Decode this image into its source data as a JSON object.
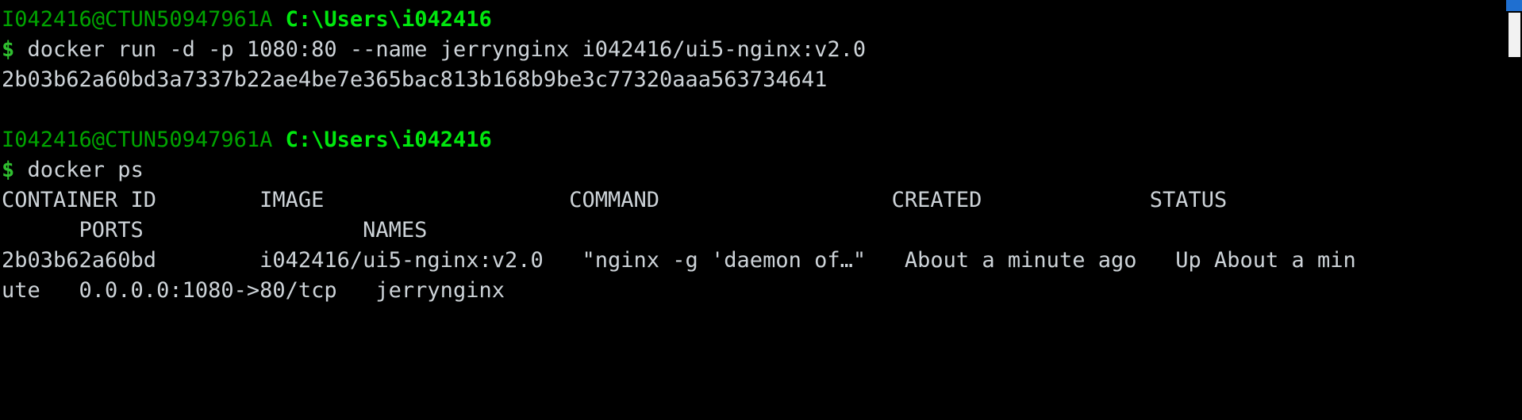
{
  "terminal": {
    "background": "#000000",
    "foreground": "#cdd3d8",
    "prompt_user_color": "#00a400",
    "prompt_path_color": "#00e80e",
    "dollar_color": "#2fbf2f",
    "scrollbar_accent_color": "#1f6fd0",
    "scrollbar_thumb_color": "#f2f2f2"
  },
  "lines": {
    "l1_user": "I042416@CTUN50947961A",
    "l1_space": " ",
    "l1_path": "C:\\Users\\i042416",
    "l2_dollar": "$",
    "l2_command": " docker run -d -p 1080:80 --name jerrynginx i042416/ui5-nginx:v2.0",
    "l3_container_hash": "2b03b62a60bd3a7337b22ae4be7e365bac813b168b9be3c77320aaa563734641",
    "l4_blank": " ",
    "l5_user": "I042416@CTUN50947961A",
    "l5_space": " ",
    "l5_path": "C:\\Users\\i042416",
    "l6_dollar": "$",
    "l6_command": " docker ps",
    "l7_header": "CONTAINER ID        IMAGE                   COMMAND                  CREATED             STATUS",
    "l8_header_wrap": "      PORTS                 NAMES",
    "l9_row": "2b03b62a60bd        i042416/ui5-nginx:v2.0   \"nginx -g 'daemon of…\"   About a minute ago   Up About a min",
    "l10_row_wrap": "ute   0.0.0.0:1080->80/tcp   jerrynginx"
  },
  "docker_ps": {
    "columns": [
      "CONTAINER ID",
      "IMAGE",
      "COMMAND",
      "CREATED",
      "STATUS",
      "PORTS",
      "NAMES"
    ],
    "rows": [
      {
        "container_id": "2b03b62a60bd",
        "image": "i042416/ui5-nginx:v2.0",
        "command": "\"nginx -g 'daemon of…\"",
        "created": "About a minute ago",
        "status": "Up About a minute",
        "ports": "0.0.0.0:1080->80/tcp",
        "names": "jerrynginx"
      }
    ]
  }
}
